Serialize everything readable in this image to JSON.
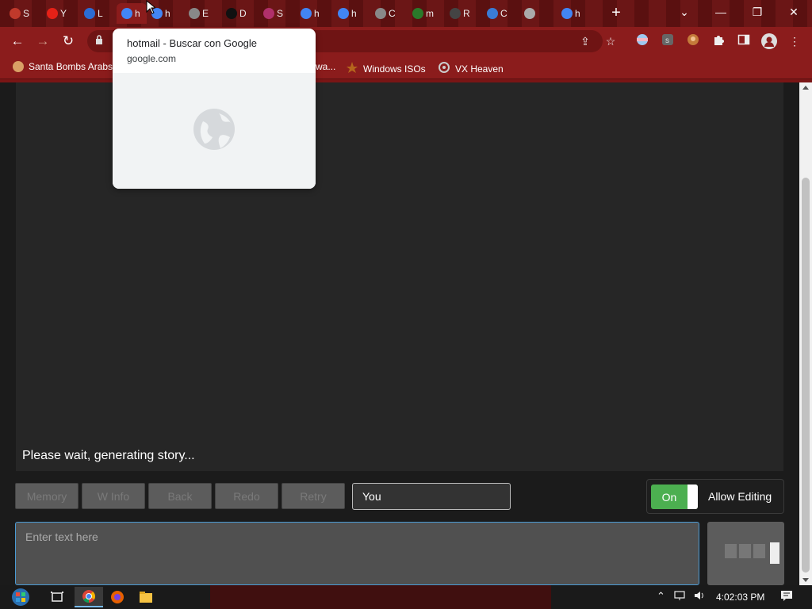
{
  "browser": {
    "tabs": [
      {
        "letter": "S",
        "color": "#c0392b"
      },
      {
        "letter": "Y",
        "color": "#e62117"
      },
      {
        "letter": "L",
        "color": "#2b6cd4"
      },
      {
        "letter": "h",
        "color": "#4285f4",
        "active": true
      },
      {
        "letter": "h",
        "color": "#4285f4"
      },
      {
        "letter": "E",
        "color": "#888888"
      },
      {
        "letter": "D",
        "color": "#111111"
      },
      {
        "letter": "S",
        "color": "#b0306a"
      },
      {
        "letter": "h",
        "color": "#4285f4"
      },
      {
        "letter": "h",
        "color": "#4285f4"
      },
      {
        "letter": "C",
        "color": "#888888"
      },
      {
        "letter": "m",
        "color": "#2a7a2a"
      },
      {
        "letter": "R",
        "color": "#444444"
      },
      {
        "letter": "C",
        "color": "#3a7bd5"
      },
      {
        "letter": "",
        "color": "#aaaaaa"
      },
      {
        "letter": "h",
        "color": "#4285f4"
      }
    ],
    "new_tab_symbol": "+",
    "window_controls": {
      "chevron": "⌄",
      "minimize": "—",
      "restore": "❐",
      "close": "✕"
    },
    "nav": {
      "back": "←",
      "forward": "→",
      "reload": "↻"
    },
    "bookmarks": [
      {
        "label": "Santa Bombs Arabs",
        "icon_color": "#d9a066"
      },
      {
        "label": "wa...",
        "icon_color": ""
      },
      {
        "label": "Windows ISOs",
        "icon_color": "#b5651d"
      },
      {
        "label": "VX Heaven",
        "icon_color": "#cccccc"
      }
    ],
    "hover_card": {
      "title": "hotmail - Buscar con Google",
      "domain": "google.com"
    }
  },
  "page": {
    "story_status": "Please wait, generating story...",
    "buttons": {
      "memory": "Memory",
      "winfo": "W Info",
      "back": "Back",
      "redo": "Redo",
      "retry": "Retry"
    },
    "actor_input_value": "You",
    "toggle_label": "On",
    "toggle_state": true,
    "allow_editing_label": "Allow Editing",
    "input_placeholder": "Enter text here"
  },
  "taskbar": {
    "time": "4:02:03 PM"
  },
  "colors": {
    "browser_frame": "#8b1c1c",
    "toggle_on": "#4caf50",
    "textarea_focus": "#4a9ad4"
  }
}
